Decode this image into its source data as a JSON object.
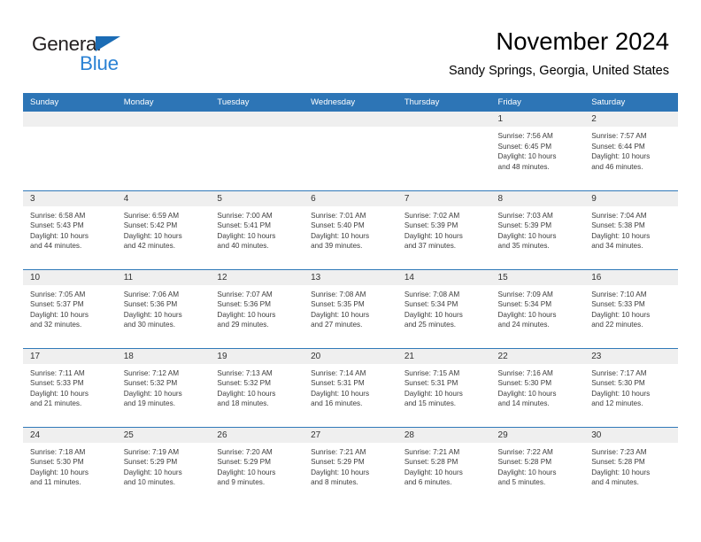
{
  "logo": {
    "text_primary": "General",
    "text_secondary": "Blue",
    "triangle_color": "#1b6cb5",
    "secondary_color": "#2b82d4"
  },
  "header": {
    "title": "November 2024",
    "subtitle": "Sandy Springs, Georgia, United States",
    "header_bg_color": "#2d75b6",
    "row_divider_color": "#3079b8",
    "daynum_band_color": "#efefef"
  },
  "weekday_headers": [
    "Sunday",
    "Monday",
    "Tuesday",
    "Wednesday",
    "Thursday",
    "Friday",
    "Saturday"
  ],
  "weeks": [
    [
      {
        "day": "",
        "empty": true
      },
      {
        "day": "",
        "empty": true
      },
      {
        "day": "",
        "empty": true
      },
      {
        "day": "",
        "empty": true
      },
      {
        "day": "",
        "empty": true
      },
      {
        "day": "1",
        "sunrise": "Sunrise: 7:56 AM",
        "sunset": "Sunset: 6:45 PM",
        "daylight_line1": "Daylight: 10 hours",
        "daylight_line2": "and 48 minutes."
      },
      {
        "day": "2",
        "sunrise": "Sunrise: 7:57 AM",
        "sunset": "Sunset: 6:44 PM",
        "daylight_line1": "Daylight: 10 hours",
        "daylight_line2": "and 46 minutes."
      }
    ],
    [
      {
        "day": "3",
        "sunrise": "Sunrise: 6:58 AM",
        "sunset": "Sunset: 5:43 PM",
        "daylight_line1": "Daylight: 10 hours",
        "daylight_line2": "and 44 minutes."
      },
      {
        "day": "4",
        "sunrise": "Sunrise: 6:59 AM",
        "sunset": "Sunset: 5:42 PM",
        "daylight_line1": "Daylight: 10 hours",
        "daylight_line2": "and 42 minutes."
      },
      {
        "day": "5",
        "sunrise": "Sunrise: 7:00 AM",
        "sunset": "Sunset: 5:41 PM",
        "daylight_line1": "Daylight: 10 hours",
        "daylight_line2": "and 40 minutes."
      },
      {
        "day": "6",
        "sunrise": "Sunrise: 7:01 AM",
        "sunset": "Sunset: 5:40 PM",
        "daylight_line1": "Daylight: 10 hours",
        "daylight_line2": "and 39 minutes."
      },
      {
        "day": "7",
        "sunrise": "Sunrise: 7:02 AM",
        "sunset": "Sunset: 5:39 PM",
        "daylight_line1": "Daylight: 10 hours",
        "daylight_line2": "and 37 minutes."
      },
      {
        "day": "8",
        "sunrise": "Sunrise: 7:03 AM",
        "sunset": "Sunset: 5:39 PM",
        "daylight_line1": "Daylight: 10 hours",
        "daylight_line2": "and 35 minutes."
      },
      {
        "day": "9",
        "sunrise": "Sunrise: 7:04 AM",
        "sunset": "Sunset: 5:38 PM",
        "daylight_line1": "Daylight: 10 hours",
        "daylight_line2": "and 34 minutes."
      }
    ],
    [
      {
        "day": "10",
        "sunrise": "Sunrise: 7:05 AM",
        "sunset": "Sunset: 5:37 PM",
        "daylight_line1": "Daylight: 10 hours",
        "daylight_line2": "and 32 minutes."
      },
      {
        "day": "11",
        "sunrise": "Sunrise: 7:06 AM",
        "sunset": "Sunset: 5:36 PM",
        "daylight_line1": "Daylight: 10 hours",
        "daylight_line2": "and 30 minutes."
      },
      {
        "day": "12",
        "sunrise": "Sunrise: 7:07 AM",
        "sunset": "Sunset: 5:36 PM",
        "daylight_line1": "Daylight: 10 hours",
        "daylight_line2": "and 29 minutes."
      },
      {
        "day": "13",
        "sunrise": "Sunrise: 7:08 AM",
        "sunset": "Sunset: 5:35 PM",
        "daylight_line1": "Daylight: 10 hours",
        "daylight_line2": "and 27 minutes."
      },
      {
        "day": "14",
        "sunrise": "Sunrise: 7:08 AM",
        "sunset": "Sunset: 5:34 PM",
        "daylight_line1": "Daylight: 10 hours",
        "daylight_line2": "and 25 minutes."
      },
      {
        "day": "15",
        "sunrise": "Sunrise: 7:09 AM",
        "sunset": "Sunset: 5:34 PM",
        "daylight_line1": "Daylight: 10 hours",
        "daylight_line2": "and 24 minutes."
      },
      {
        "day": "16",
        "sunrise": "Sunrise: 7:10 AM",
        "sunset": "Sunset: 5:33 PM",
        "daylight_line1": "Daylight: 10 hours",
        "daylight_line2": "and 22 minutes."
      }
    ],
    [
      {
        "day": "17",
        "sunrise": "Sunrise: 7:11 AM",
        "sunset": "Sunset: 5:33 PM",
        "daylight_line1": "Daylight: 10 hours",
        "daylight_line2": "and 21 minutes."
      },
      {
        "day": "18",
        "sunrise": "Sunrise: 7:12 AM",
        "sunset": "Sunset: 5:32 PM",
        "daylight_line1": "Daylight: 10 hours",
        "daylight_line2": "and 19 minutes."
      },
      {
        "day": "19",
        "sunrise": "Sunrise: 7:13 AM",
        "sunset": "Sunset: 5:32 PM",
        "daylight_line1": "Daylight: 10 hours",
        "daylight_line2": "and 18 minutes."
      },
      {
        "day": "20",
        "sunrise": "Sunrise: 7:14 AM",
        "sunset": "Sunset: 5:31 PM",
        "daylight_line1": "Daylight: 10 hours",
        "daylight_line2": "and 16 minutes."
      },
      {
        "day": "21",
        "sunrise": "Sunrise: 7:15 AM",
        "sunset": "Sunset: 5:31 PM",
        "daylight_line1": "Daylight: 10 hours",
        "daylight_line2": "and 15 minutes."
      },
      {
        "day": "22",
        "sunrise": "Sunrise: 7:16 AM",
        "sunset": "Sunset: 5:30 PM",
        "daylight_line1": "Daylight: 10 hours",
        "daylight_line2": "and 14 minutes."
      },
      {
        "day": "23",
        "sunrise": "Sunrise: 7:17 AM",
        "sunset": "Sunset: 5:30 PM",
        "daylight_line1": "Daylight: 10 hours",
        "daylight_line2": "and 12 minutes."
      }
    ],
    [
      {
        "day": "24",
        "sunrise": "Sunrise: 7:18 AM",
        "sunset": "Sunset: 5:30 PM",
        "daylight_line1": "Daylight: 10 hours",
        "daylight_line2": "and 11 minutes."
      },
      {
        "day": "25",
        "sunrise": "Sunrise: 7:19 AM",
        "sunset": "Sunset: 5:29 PM",
        "daylight_line1": "Daylight: 10 hours",
        "daylight_line2": "and 10 minutes."
      },
      {
        "day": "26",
        "sunrise": "Sunrise: 7:20 AM",
        "sunset": "Sunset: 5:29 PM",
        "daylight_line1": "Daylight: 10 hours",
        "daylight_line2": "and 9 minutes."
      },
      {
        "day": "27",
        "sunrise": "Sunrise: 7:21 AM",
        "sunset": "Sunset: 5:29 PM",
        "daylight_line1": "Daylight: 10 hours",
        "daylight_line2": "and 8 minutes."
      },
      {
        "day": "28",
        "sunrise": "Sunrise: 7:21 AM",
        "sunset": "Sunset: 5:28 PM",
        "daylight_line1": "Daylight: 10 hours",
        "daylight_line2": "and 6 minutes."
      },
      {
        "day": "29",
        "sunrise": "Sunrise: 7:22 AM",
        "sunset": "Sunset: 5:28 PM",
        "daylight_line1": "Daylight: 10 hours",
        "daylight_line2": "and 5 minutes."
      },
      {
        "day": "30",
        "sunrise": "Sunrise: 7:23 AM",
        "sunset": "Sunset: 5:28 PM",
        "daylight_line1": "Daylight: 10 hours",
        "daylight_line2": "and 4 minutes."
      }
    ]
  ]
}
